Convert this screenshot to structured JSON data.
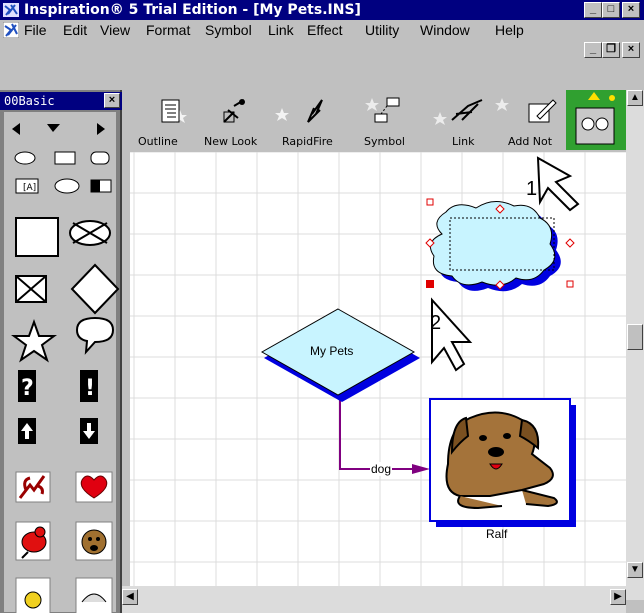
{
  "window": {
    "title": "Inspiration® 5 Trial Edition - [My Pets.INS]",
    "minimize": "_",
    "maximize": "□",
    "close": "×"
  },
  "menu": {
    "items": [
      "File",
      "Edit",
      "View",
      "Format",
      "Symbol",
      "Link",
      "Effect",
      "Utility",
      "Window",
      "Help"
    ]
  },
  "mdi": {
    "minimize": "_",
    "restore": "❐",
    "close": "×"
  },
  "palette": {
    "title": "00Basic",
    "close": "×"
  },
  "toolbar": {
    "buttons": [
      "Outline",
      "New Look",
      "RapidFire",
      "Symbol",
      "Link",
      "Add Not"
    ]
  },
  "diagram": {
    "main_symbol": "My Pets",
    "link_label": "dog",
    "image_caption": "Ralf"
  },
  "callouts": [
    "1",
    "2"
  ],
  "colors": {
    "titlebar": "#000080",
    "symbol_fill": "#c8f4ff",
    "symbol_shadow": "#0000e0",
    "link_line": "#800080",
    "handle": "#e00000"
  }
}
